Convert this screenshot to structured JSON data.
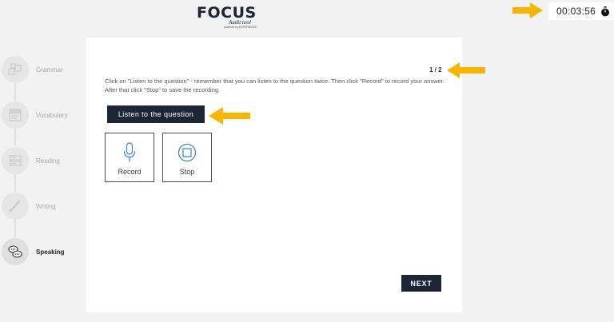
{
  "logo": {
    "word": "FOCUS",
    "subtitle": "Audit tool",
    "tiny": "powered by EXPERIENCE"
  },
  "timer": {
    "value": "00:03:56",
    "icon": "stopwatch-icon"
  },
  "sidebar": {
    "items": [
      {
        "label": "Grammar",
        "icon": "grammar-icon",
        "active": false
      },
      {
        "label": "Vocabulary",
        "icon": "vocabulary-icon",
        "active": false
      },
      {
        "label": "Reading",
        "icon": "reading-icon",
        "active": false
      },
      {
        "label": "Writing",
        "icon": "writing-icon",
        "active": false
      },
      {
        "label": "Speaking",
        "icon": "speaking-icon",
        "active": true
      }
    ]
  },
  "task": {
    "counter": "1 / 2",
    "instruction": "Click on \"Listen to the question\" - remember that you can listen to the question twice. Then click \"Record\" to record your answer. After that click \"Stop\" to save the recording.",
    "listen_label": "Listen to the question",
    "record_label": "Record",
    "stop_label": "Stop",
    "next_label": "NEXT"
  },
  "colors": {
    "accent": "#1c2636",
    "arrow": "#f7b500",
    "icon_blue": "#3b7fc4",
    "background": "#f2f2f2"
  }
}
